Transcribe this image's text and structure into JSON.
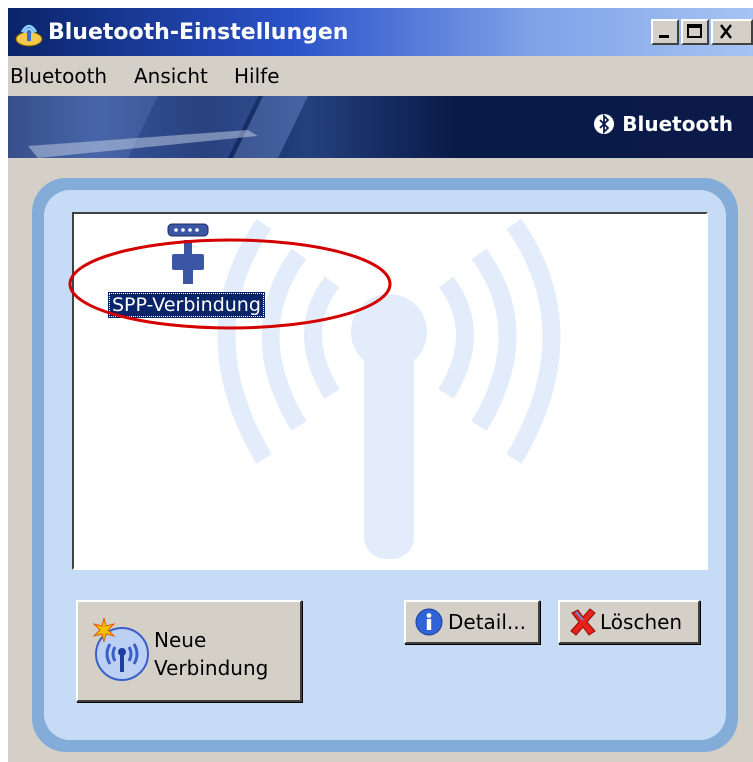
{
  "window": {
    "title": "Bluetooth-Einstellungen",
    "controls": [
      "minimize",
      "maximize",
      "close"
    ]
  },
  "menu": {
    "items": [
      {
        "label": "Bluetooth"
      },
      {
        "label": "Ansicht"
      },
      {
        "label": "Hilfe"
      }
    ]
  },
  "banner": {
    "brand": "Bluetooth"
  },
  "connections": {
    "items": [
      {
        "label": "SPP-Verbindung",
        "icon": "serial-port-icon",
        "selected": true
      }
    ]
  },
  "buttons": {
    "new_connection": {
      "line1": "Neue",
      "line2": "Verbindung",
      "icon": "new-connection-icon"
    },
    "details": {
      "label": "Detail...",
      "icon": "info-icon"
    },
    "delete": {
      "label": "Löschen",
      "icon": "delete-icon"
    }
  },
  "colors": {
    "title_bar": "#0a246a",
    "selection": "#0a246a",
    "panel_border": "#84acd8",
    "panel_fill": "#c6dbf6",
    "annotation": "#d40000"
  }
}
